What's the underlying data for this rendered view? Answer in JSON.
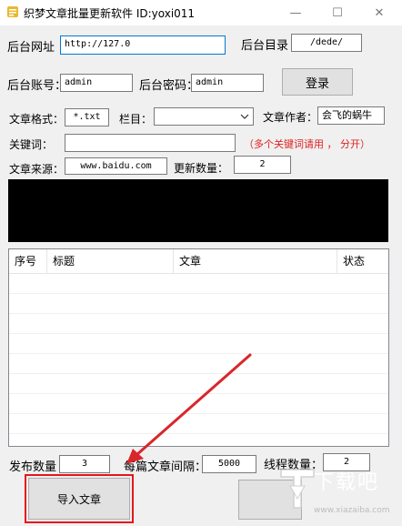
{
  "window": {
    "title": "织梦文章批量更新软件   ID:yoxi011",
    "minimize_glyph": "—",
    "maximize_glyph": "☐",
    "close_glyph": "✕"
  },
  "login": {
    "backend_url_label": "后台网址",
    "backend_url_value": "http://127.0",
    "backend_dir_label": "后台目录",
    "backend_dir_value": "/dede/",
    "account_label": "后台账号：",
    "account_value": "admin",
    "password_label": "后台密码：",
    "password_value": "admin",
    "login_button": "登录"
  },
  "article": {
    "format_label": "文章格式：",
    "format_value": "*.txt",
    "column_label": "栏目：",
    "column_value": "",
    "author_label": "文章作者：",
    "author_value": "会飞的蜗牛",
    "keywords_label": "关键词：",
    "keywords_value": "",
    "keywords_note": "（多个关键词请用 ， 分开）",
    "source_label": "文章来源：",
    "source_value": "www.baidu.com",
    "update_count_label": "更新数量：",
    "update_count_value": "2"
  },
  "table": {
    "columns": [
      "序号",
      "标题",
      "文章",
      "状态"
    ]
  },
  "bottom": {
    "publish_count_label": "发布数量",
    "publish_count_value": "3",
    "interval_label": "每篇文章间隔：",
    "interval_value": "5000",
    "threads_label": "线程数量：",
    "threads_value": "2",
    "import_button": "导入文章"
  },
  "watermark": {
    "text": "下载吧",
    "url": "www.xiazaiba.com"
  },
  "colors": {
    "highlight": "#e8141b",
    "arrow": "#d9262b",
    "note": "#e02020",
    "focus_border": "#0078d7"
  }
}
